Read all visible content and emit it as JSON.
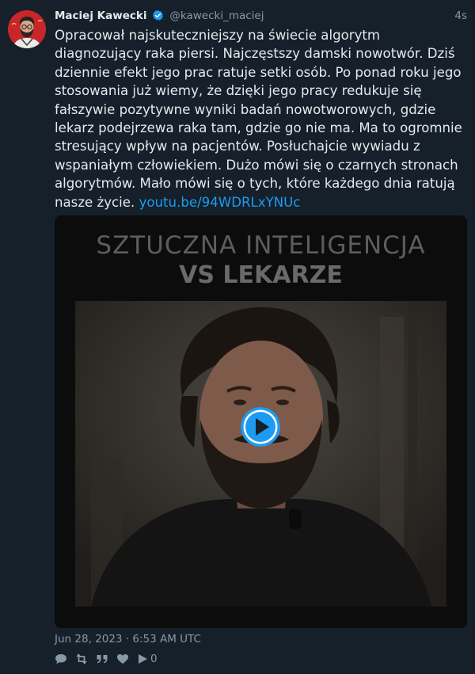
{
  "tweet": {
    "author_name": "Maciej Kawecki",
    "handle": "@kawecki_maciej",
    "relative_time": "4s",
    "text": "Opracował najskuteczniejszy na świecie algorytm diagnozujący raka piersi. Najczęstszy damski nowotwór. Dziś dziennie efekt jego prac ratuje setki osób. Po ponad roku jego stosowania już wiemy, że dzięki jego pracy redukuje się fałszywie pozytywne wyniki badań nowotworowych, gdzie lekarz podejrzewa raka tam, gdzie go nie ma. Ma to ogromnie stresujący wpływ na pacjentów. Posłuchajcie wywiadu z wspaniałym człowiekiem. Dużo mówi się o czarnych stronach algorytmów. Mało mówi się o tych, które każdego dnia ratują nasze życie.",
    "link_text": "youtu.be/94WDRLxYNUc",
    "timestamp": "Jun 28, 2023 · 6:53 AM UTC",
    "views": "0"
  },
  "media": {
    "title_line1": "SZTUCZNA INTELIGENCJA",
    "title_line2": "VS LEKARZE"
  },
  "colors": {
    "background": "#15202b",
    "text": "#e7e9ea",
    "muted": "#8899a6",
    "link": "#1d9bf0",
    "verified": "#1d9bf0",
    "play_button": "#1d9bf0"
  },
  "icons": {
    "verified": "verified-badge-icon",
    "reply": "reply-icon",
    "retweet": "retweet-icon",
    "quote": "quote-icon",
    "like": "heart-icon",
    "views": "play-views-icon",
    "play": "play-button-icon"
  }
}
